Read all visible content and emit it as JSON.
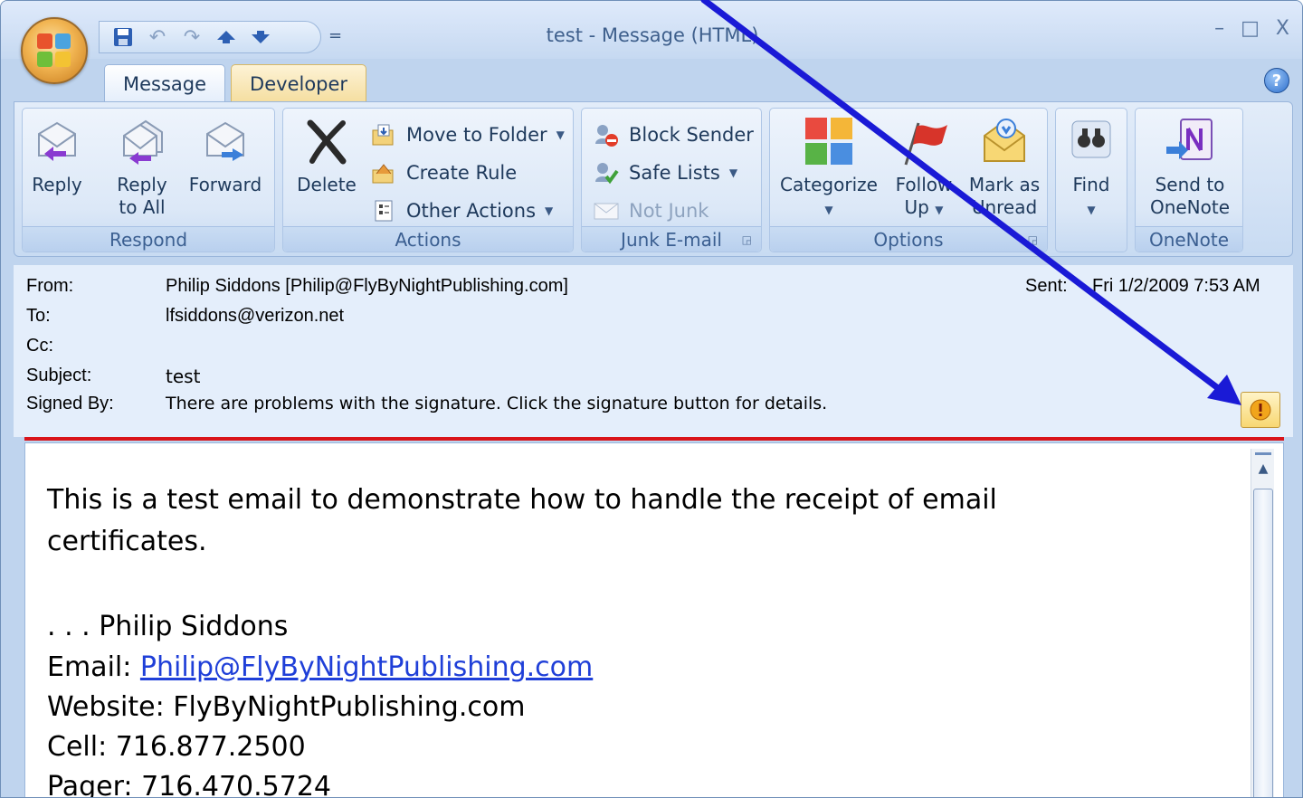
{
  "window": {
    "title": "test - Message (HTML)",
    "controls": [
      "–",
      "□",
      "X"
    ]
  },
  "qat": {
    "icons": [
      "save-icon",
      "undo-icon",
      "redo-icon",
      "previous-item-icon",
      "next-item-icon"
    ],
    "customize_label": "="
  },
  "tabs": [
    {
      "label": "Message",
      "active": true
    },
    {
      "label": "Developer",
      "active": false
    }
  ],
  "ribbon": {
    "respond": {
      "label": "Respond",
      "reply": "Reply",
      "reply_all_1": "Reply",
      "reply_all_2": "to All",
      "forward": "Forward"
    },
    "actions": {
      "label": "Actions",
      "delete": "Delete",
      "move_to_folder": "Move to Folder",
      "create_rule": "Create Rule",
      "other_actions": "Other Actions"
    },
    "junk": {
      "label": "Junk E-mail",
      "block_sender": "Block Sender",
      "safe_lists": "Safe Lists",
      "not_junk": "Not Junk"
    },
    "options": {
      "label": "Options",
      "categorize": "Categorize",
      "follow_up_1": "Follow",
      "follow_up_2": "Up",
      "mark_unread_1": "Mark as",
      "mark_unread_2": "Unread"
    },
    "find": {
      "label": "Find"
    },
    "onenote": {
      "label": "OneNote",
      "send_1": "Send to",
      "send_2": "OneNote"
    }
  },
  "header": {
    "from_label": "From:",
    "from_value": "Philip Siddons [Philip@FlyByNightPublishing.com]",
    "to_label": "To:",
    "to_value": "lfsiddons@verizon.net",
    "cc_label": "Cc:",
    "cc_value": "",
    "subject_label": "Subject:",
    "subject_value": "test",
    "signed_label": "Signed By:",
    "signed_value": "There are problems with the signature. Click the signature button for details.",
    "sent_label": "Sent:",
    "sent_value": "Fri 1/2/2009 7:53 AM"
  },
  "body": {
    "intro": "This is a test email to demonstrate how to handle the receipt of email certificates.",
    "signature_name": ". . . Philip Siddons",
    "email_label": "Email: ",
    "email_value": "Philip@FlyByNightPublishing.com",
    "website": "Website: FlyByNightPublishing.com",
    "cell": "Cell: 716.877.2500",
    "pager": "Pager: 716.470.5724"
  },
  "colors": {
    "accent_blue": "#1f3fd8",
    "separator_red": "#d9141a",
    "annotation_arrow": "#1a1ad6"
  }
}
